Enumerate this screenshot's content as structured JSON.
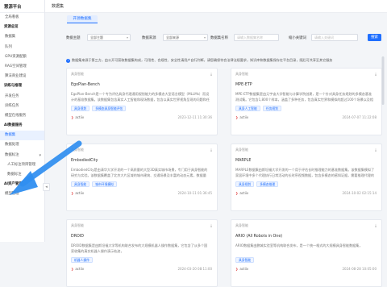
{
  "app": {
    "title": "慧源平台"
  },
  "sidebar": {
    "items": [
      {
        "label": "全局看板",
        "type": "item"
      },
      {
        "label": "资源总览",
        "type": "group"
      },
      {
        "label": "数据集",
        "type": "item"
      },
      {
        "label": "队列",
        "type": "item"
      },
      {
        "label": "GPU资源配额",
        "type": "item"
      },
      {
        "label": "RAG空间管理",
        "type": "item"
      },
      {
        "label": "算法商业建设",
        "type": "item"
      },
      {
        "label": "训练与推理",
        "type": "group"
      },
      {
        "label": "开发任务",
        "type": "item"
      },
      {
        "label": "训练任务",
        "type": "item"
      },
      {
        "label": "模型在线服务",
        "type": "item"
      },
      {
        "label": "AI数据服务",
        "type": "group"
      },
      {
        "label": "数据集",
        "type": "item",
        "active": true
      },
      {
        "label": "数据处理",
        "type": "item"
      },
      {
        "label": "数据标注",
        "type": "item",
        "chevron": true
      },
      {
        "label": "人工标注项目管理",
        "type": "sub"
      },
      {
        "label": "数据标注",
        "type": "sub"
      },
      {
        "label": "AI资产管理",
        "type": "group"
      },
      {
        "label": "模型管理",
        "type": "item"
      }
    ]
  },
  "header": {
    "breadcrumb": "数据集"
  },
  "tabs": [
    {
      "label": "开源数据集",
      "active": true
    }
  ],
  "filters": {
    "topic_label": "数据主题",
    "topic_value": "全部主题",
    "source_label": "数据来源",
    "source_value": "全部来源",
    "name_label": "数据集名称",
    "name_placeholder": "请输入数据集名称",
    "keyword_label": "缩小关键词",
    "keyword_placeholder": "请输入关键词",
    "search_label": "搜索"
  },
  "notice": "数据集来源于第三方，由公开可获取数据集构成，可用性、合规性、安全性请用户自行判断，请您确保符合法律法规要求，知识库和数据集保存在平台目录，随后可共享至其它服务",
  "cards": [
    {
      "tag": "具身智能",
      "title": "EgoPlan-Bench",
      "desc": "EgoPlan-Bench是一个专为评估具身代理通用规划能力的多模态大型语言模型（MLLMs）而设计的基准数据集。该数据集包含真实人工智能和现场数据，包含以真实世界视角呈现的问题和任务序列，涉及与",
      "chips": [
        "具身规划",
        "多模态具身智能评估"
      ],
      "org": "actiiv",
      "date": "2023-12-11 11:30:36"
    },
    {
      "tag": "具身智能",
      "title": "MPE-ETP",
      "desc": "MPE-ETP数据集是由元宇宙大学智能与计算学院创建，是一个针对具身任务规划的多模态基准测试集。它包含1,800个样本，涵盖了多种任务，包含真实世界和模拟的超过100个场景以及相对机器人任务类型，",
      "chips": [
        "具身人工智能",
        "任务规划"
      ],
      "org": "actiiv",
      "date": "2024-07-07 11:22:08"
    },
    {
      "tag": "具身智能",
      "title": "EmbodiedCity",
      "desc": "EmbodiedCity是由清华大学开发的一个高质量的大型3D真实城市场景，专门用于具身智能的研究与实验。该数据集覆盖了北京大片区域的城市建筑、交通场景及丰富的动态元素，数据量大、丰富的城市场景",
      "chips": [
        "具身智能",
        "城市环境模拟"
      ],
      "org": "actiiv",
      "date": "2024-10-11 01:36:45"
    },
    {
      "tag": "具身智能",
      "title": "MARPLE",
      "desc": "MARPLE数据集由斯坦福大学开发的一个用于评估长时推理能力的基准数据集。该数据集模拟了家居环境中多个代理执行日常活动的长时序视频数据，包含多模态的感知证据，需要推理代理的行为及原因，",
      "chips": [
        "具身规划",
        "多模态推理"
      ],
      "org": "actiiv",
      "date": "2024-10-02 02:15:14"
    },
    {
      "tag": "具身智能",
      "title": "DROID",
      "desc": "DROID数据集是由斯坦福大学等机构联合发布的大规模机器人操作数据集，它包含了从多个国家收集的真实机器人操作演示轨迹，",
      "chips": [
        "机器人操作"
      ],
      "org": "actiiv",
      "date": "2024-03-20 08:11:00"
    },
    {
      "tag": "具身智能",
      "title": "ARIO (All Robots in One)",
      "desc": "ARIO数据集由鹏城实验室等机构联合发布，是一个统一格式的大规模具身智能数据集，",
      "chips": [
        "具身智能"
      ],
      "org": "actiiv",
      "date": "2024-08-28 10:05:00"
    }
  ],
  "card_download_icon": "download-icon",
  "colors": {
    "accent": "#1f6fff",
    "arrow": "#2f8ef0",
    "brand_mark": "#e24b4b"
  }
}
